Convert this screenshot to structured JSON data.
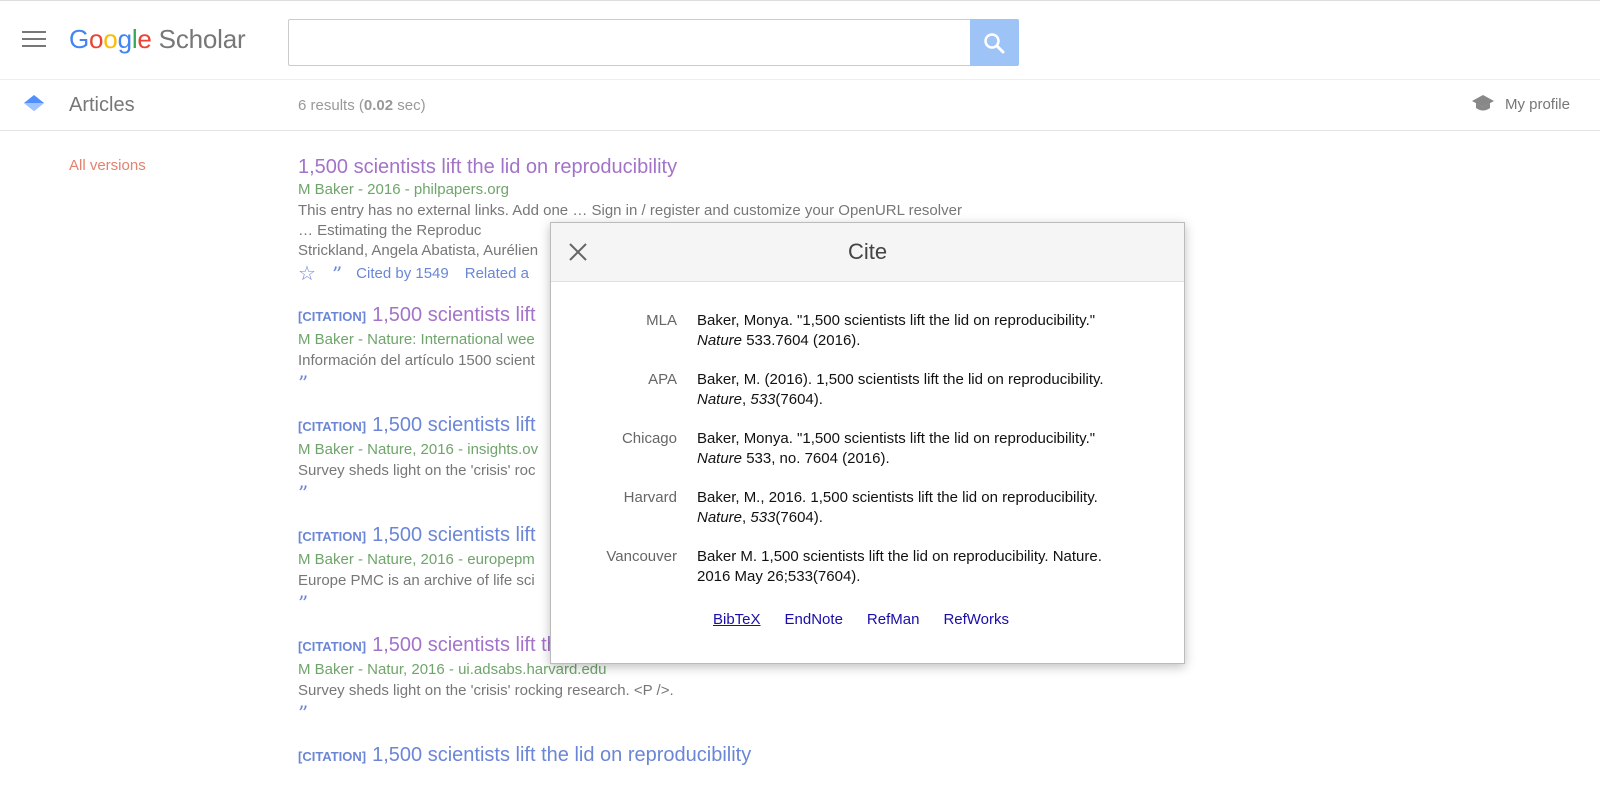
{
  "header": {
    "logo_google": "Google",
    "logo_scholar": "Scholar",
    "search_value": ""
  },
  "subbar": {
    "section_label": "Articles",
    "results_prefix": "6 results (",
    "results_time": "0.02",
    "results_suffix": " sec)",
    "profile_label": "My profile"
  },
  "sidebar": {
    "all_versions": "All versions"
  },
  "results": [
    {
      "tag": "",
      "title": "1,500 scientists lift the lid on reproducibility",
      "meta": "M Baker - 2016 - philpapers.org",
      "snippet": "This entry has no external links. Add one … Sign in / register and customize your OpenURL resolver … Estimating the Reproduc",
      "snippet2": "Strickland, Angela Abatista, Aurélien",
      "cited_by": "Cited by 1549",
      "related": "Related a"
    },
    {
      "tag": "[CITATION]",
      "title": "1,500 scientists lift",
      "meta": "M Baker - Nature: International wee",
      "snippet": "Información del artículo 1500 scient"
    },
    {
      "tag": "[CITATION]",
      "title": "1,500 scientists lift",
      "meta": "M Baker - Nature, 2016 - insights.ov",
      "snippet": "Survey sheds light on the 'crisis' roc"
    },
    {
      "tag": "[CITATION]",
      "title": "1,500 scientists lift",
      "meta": "M Baker - Nature, 2016 - europepm",
      "snippet": "Europe PMC is an archive of life sci"
    },
    {
      "tag": "[CITATION]",
      "title": "1,500 scientists lift the lid on reproducibility",
      "meta": "M Baker - Natur, 2016 - ui.adsabs.harvard.edu",
      "snippet": "Survey sheds light on the 'crisis' rocking research. <P />."
    },
    {
      "tag": "[CITATION]",
      "title": "1,500 scientists lift the lid on reproducibility"
    }
  ],
  "cite_modal": {
    "title": "Cite",
    "rows": [
      {
        "label": "MLA",
        "text_a": "Baker, Monya. \"1,500 scientists lift the lid on reproducibility.\" ",
        "ital": "Nature",
        "text_b": " 533.7604 (2016)."
      },
      {
        "label": "APA",
        "text_a": "Baker, M. (2016). 1,500 scientists lift the lid on reproducibility. ",
        "ital": "Nature",
        "text_b": ", ",
        "ital2": "533",
        "text_c": "(7604)."
      },
      {
        "label": "Chicago",
        "text_a": "Baker, Monya. \"1,500 scientists lift the lid on reproducibility.\" ",
        "ital": "Nature",
        "text_b": " 533, no. 7604 (2016)."
      },
      {
        "label": "Harvard",
        "text_a": "Baker, M., 2016. 1,500 scientists lift the lid on reproducibility. ",
        "ital": "Nature",
        "text_b": ", ",
        "ital2": "533",
        "text_c": "(7604)."
      },
      {
        "label": "Vancouver",
        "text_a": "Baker M. 1,500 scientists lift the lid on reproducibility. Nature. 2016 May 26;533(7604)."
      }
    ],
    "exports": [
      "BibTeX",
      "EndNote",
      "RefMan",
      "RefWorks"
    ]
  }
}
